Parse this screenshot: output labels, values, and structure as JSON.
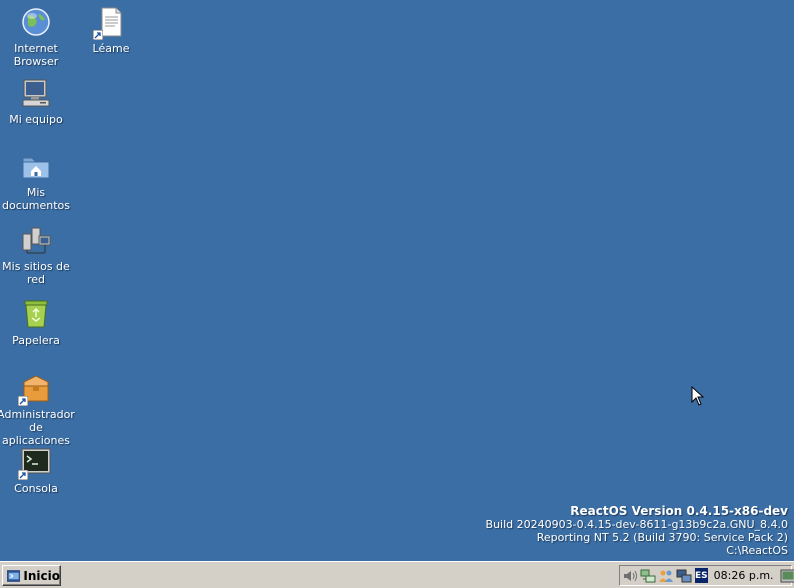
{
  "desktop": {
    "background_color": "#3a6ea5",
    "icons": [
      {
        "name": "internet-browser",
        "label": "Internet\nBrowser",
        "icon": "globe-icon"
      },
      {
        "name": "leame",
        "label": "Léame",
        "icon": "document-icon"
      },
      {
        "name": "mi-equipo",
        "label": "Mi equipo",
        "icon": "computer-icon"
      },
      {
        "name": "mis-documentos",
        "label": "Mis\ndocumentos",
        "icon": "folder-home-icon"
      },
      {
        "name": "mis-sitios-de-red",
        "label": "Mis sitios de\nred",
        "icon": "network-icon"
      },
      {
        "name": "papelera",
        "label": "Papelera",
        "icon": "recycle-bin-icon"
      },
      {
        "name": "administrador-de-aplicaciones",
        "label": "Administrador\nde aplicaciones",
        "icon": "package-icon"
      },
      {
        "name": "consola",
        "label": "Consola",
        "icon": "console-icon"
      }
    ],
    "version": {
      "title": "ReactOS Version 0.4.15-x86-dev",
      "build": "Build 20240903-0.4.15-dev-8611-g13b9c2a.GNU_8.4.0",
      "reporting": "Reporting NT 5.2 (Build 3790: Service Pack 2)",
      "path": "C:\\ReactOS"
    }
  },
  "taskbar": {
    "start_label": "Inicio",
    "language": "ES",
    "clock": "08:26 p.m.",
    "tray_icons": [
      "volume-icon",
      "network-tray-icon",
      "people-icon",
      "display-icon"
    ]
  }
}
